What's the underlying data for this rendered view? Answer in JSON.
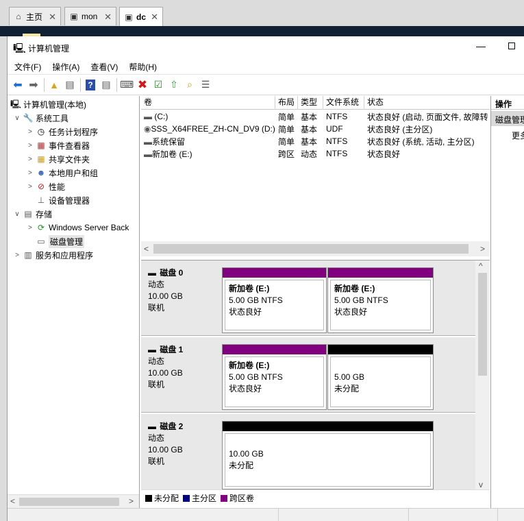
{
  "browser": {
    "tabs": [
      {
        "label": "主页",
        "icon": "home-icon",
        "close": "✕"
      },
      {
        "label": "mon",
        "icon": "vm-icon",
        "close": "✕"
      },
      {
        "label": "dc",
        "icon": "vm-icon",
        "close": "✕"
      }
    ]
  },
  "window": {
    "title": "计算机管理",
    "minimize": "—",
    "menu": [
      "文件(F)",
      "操作(A)",
      "查看(V)",
      "帮助(H)"
    ]
  },
  "toolbar": {
    "buttons": [
      "back-icon",
      "forward-icon",
      "up-folder-icon",
      "show-hide-tree-icon",
      "help-icon",
      "properties-icon",
      "connect-icon",
      "delete-icon",
      "check-icon",
      "import-icon",
      "search-icon",
      "list-icon"
    ]
  },
  "tree": {
    "items": [
      {
        "label": "计算机管理(本地)",
        "level": 0,
        "arrow": "",
        "icon": "computer-icon"
      },
      {
        "label": "系统工具",
        "level": 1,
        "arrow": "∨",
        "icon": "tools-icon"
      },
      {
        "label": "任务计划程序",
        "level": 2,
        "arrow": ">",
        "icon": "clock-icon"
      },
      {
        "label": "事件查看器",
        "level": 2,
        "arrow": ">",
        "icon": "event-icon"
      },
      {
        "label": "共享文件夹",
        "level": 2,
        "arrow": ">",
        "icon": "shared-folder-icon"
      },
      {
        "label": "本地用户和组",
        "level": 2,
        "arrow": ">",
        "icon": "users-icon"
      },
      {
        "label": "性能",
        "level": 2,
        "arrow": ">",
        "icon": "performance-icon"
      },
      {
        "label": "设备管理器",
        "level": 2,
        "arrow": "",
        "icon": "device-icon"
      },
      {
        "label": "存储",
        "level": 1,
        "arrow": "∨",
        "icon": "storage-icon"
      },
      {
        "label": "Windows Server Back",
        "level": 2,
        "arrow": ">",
        "icon": "backup-icon"
      },
      {
        "label": "磁盘管理",
        "level": 2,
        "arrow": "",
        "icon": "disk-icon",
        "selected": true
      },
      {
        "label": "服务和应用程序",
        "level": 1,
        "arrow": ">",
        "icon": "services-icon"
      }
    ]
  },
  "volumes": {
    "headers": [
      "卷",
      "布局",
      "类型",
      "文件系统",
      "状态"
    ],
    "rows": [
      {
        "name": "(C:)",
        "layout": "简单",
        "type": "基本",
        "fs": "NTFS",
        "status": "状态良好 (启动, 页面文件, 故障转"
      },
      {
        "name": "SSS_X64FREE_ZH-CN_DV9 (D:)",
        "layout": "简单",
        "type": "基本",
        "fs": "UDF",
        "status": "状态良好 (主分区)"
      },
      {
        "name": "系统保留",
        "layout": "简单",
        "type": "基本",
        "fs": "NTFS",
        "status": "状态良好 (系统, 活动, 主分区)"
      },
      {
        "name": "新加卷 (E:)",
        "layout": "跨区",
        "type": "动态",
        "fs": "NTFS",
        "status": "状态良好"
      }
    ]
  },
  "disks": [
    {
      "name": "磁盘 0",
      "kind": "动态",
      "size": "10.00 GB",
      "state": "联机",
      "partitions": [
        {
          "title": "新加卷  (E:)",
          "line1": "5.00 GB NTFS",
          "line2": "状态良好",
          "color": "#800080"
        },
        {
          "title": "新加卷  (E:)",
          "line1": "5.00 GB NTFS",
          "line2": "状态良好",
          "color": "#800080"
        }
      ]
    },
    {
      "name": "磁盘 1",
      "kind": "动态",
      "size": "10.00 GB",
      "state": "联机",
      "partitions": [
        {
          "title": "新加卷  (E:)",
          "line1": "5.00 GB NTFS",
          "line2": "状态良好",
          "color": "#800080"
        },
        {
          "title": "",
          "line1": "5.00 GB",
          "line2": "未分配",
          "color": "#000000"
        }
      ]
    },
    {
      "name": "磁盘 2",
      "kind": "动态",
      "size": "10.00 GB",
      "state": "联机",
      "partitions": [
        {
          "title": "",
          "line1": "10.00 GB",
          "line2": "未分配",
          "color": "#000000"
        }
      ]
    }
  ],
  "legend": [
    {
      "label": "未分配",
      "color": "#000000"
    },
    {
      "label": "主分区",
      "color": "#000080"
    },
    {
      "label": "跨区卷",
      "color": "#800080"
    }
  ],
  "actions": {
    "header": "操作",
    "selected": "磁盘管理",
    "more": "更多操作"
  }
}
